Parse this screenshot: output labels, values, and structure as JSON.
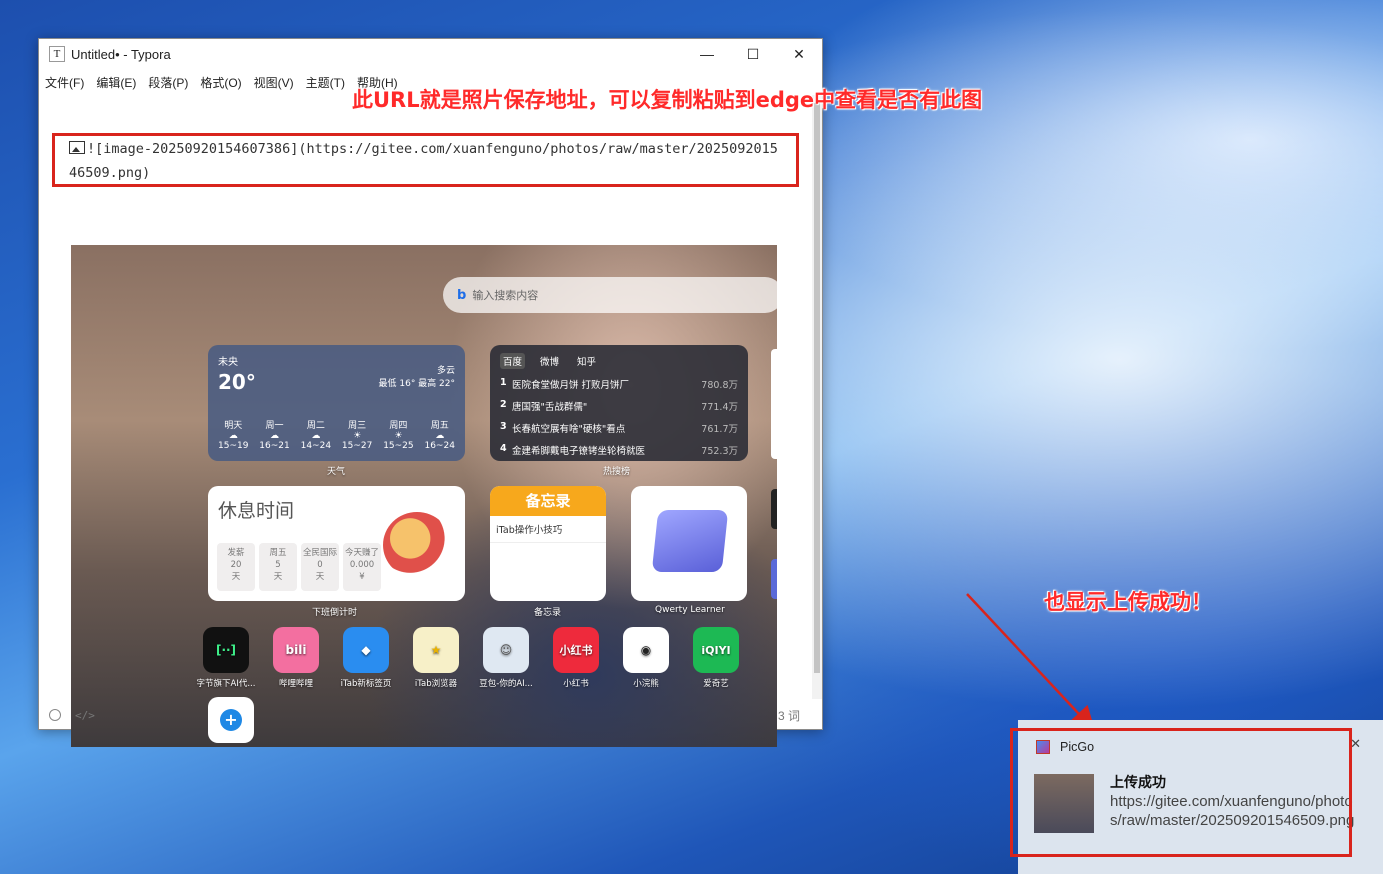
{
  "window": {
    "title": "Untitled• - Typora",
    "app_icon": "T",
    "controls": {
      "minimize": "—",
      "maximize": "☐",
      "close": "✕"
    }
  },
  "menu": [
    "文件(F)",
    "编辑(E)",
    "段落(P)",
    "格式(O)",
    "视图(V)",
    "主题(T)",
    "帮助(H)"
  ],
  "editor": {
    "markdown": "![image-20250920154607386](https://gitee.com/xuanfenguno/photos/raw/master/202509201546509.png)"
  },
  "annotations": {
    "url_note": "此URL就是照片保存地址，可以复制粘贴到edge中查看是否有此图",
    "upload_note": "也显示上传成功！"
  },
  "statusbar": {
    "word_count": "3 词",
    "code_toggle": "</>"
  },
  "embedded": {
    "search_placeholder": "输入搜索内容",
    "weather": {
      "location": "未央",
      "temp": "20°",
      "condition": "多云",
      "range": "最低 16° 最高 22°",
      "days": [
        {
          "name": "明天",
          "range": "15~19"
        },
        {
          "name": "周一",
          "range": "16~21"
        },
        {
          "name": "周二",
          "range": "14~24"
        },
        {
          "name": "周三",
          "range": "15~27"
        },
        {
          "name": "周四",
          "range": "15~25"
        },
        {
          "name": "周五",
          "range": "16~24"
        }
      ],
      "label": "天气"
    },
    "hot": {
      "tabs": [
        "百度",
        "微博",
        "知乎"
      ],
      "rows": [
        {
          "n": "1",
          "title": "医院食堂做月饼 打败月饼厂",
          "value": "780.8万"
        },
        {
          "n": "2",
          "title": "唐国强\"舌战群儒\"",
          "value": "771.4万"
        },
        {
          "n": "3",
          "title": "长春航空展有啥\"硬核\"看点",
          "value": "761.7万"
        },
        {
          "n": "4",
          "title": "金建希脚戴电子镣铐坐轮椅就医",
          "value": "752.3万"
        }
      ],
      "label": "热搜榜"
    },
    "rest": {
      "title": "休息时间",
      "boxes": [
        {
          "l1": "发薪",
          "l2": "20",
          "l3": "天"
        },
        {
          "l1": "周五",
          "l2": "5",
          "l3": "天"
        },
        {
          "l1": "全民国际",
          "l2": "0",
          "l3": "天"
        },
        {
          "l1": "今天赚了",
          "l2": "0.000",
          "l3": "¥"
        }
      ],
      "label": "下班倒计时"
    },
    "memo": {
      "header": "备忘录",
      "item": "iTab操作小技巧",
      "label": "备忘录"
    },
    "qwerty": {
      "label": "Qwerty Learner"
    },
    "apps": [
      {
        "name": "字节旗下AI代...",
        "text": "[··]",
        "color": "#111111"
      },
      {
        "name": "哔哩哔哩",
        "text": "bili",
        "color": "#f36fa0"
      },
      {
        "name": "iTab新标签页",
        "text": "◆",
        "color": "#2a8df0"
      },
      {
        "name": "iTab浏览器",
        "text": "★",
        "color": "#f7f0c8"
      },
      {
        "name": "豆包-你的AI...",
        "text": "☺",
        "color": "#dfe8f2"
      },
      {
        "name": "小红书",
        "text": "小红书",
        "color": "#ee2a3c"
      },
      {
        "name": "小浣熊",
        "text": "◉",
        "color": "#ffffff"
      },
      {
        "name": "爱奇艺",
        "text": "iQIYI",
        "color": "#1db954"
      }
    ]
  },
  "toast": {
    "app": "PicGo",
    "close": "✕",
    "title": "上传成功",
    "body": "https://gitee.com/xuanfenguno/photos/raw/master/202509201546509.png"
  },
  "colors": {
    "annotation_red": "#d9241c",
    "desktop_blue": "#2a6fd1"
  }
}
